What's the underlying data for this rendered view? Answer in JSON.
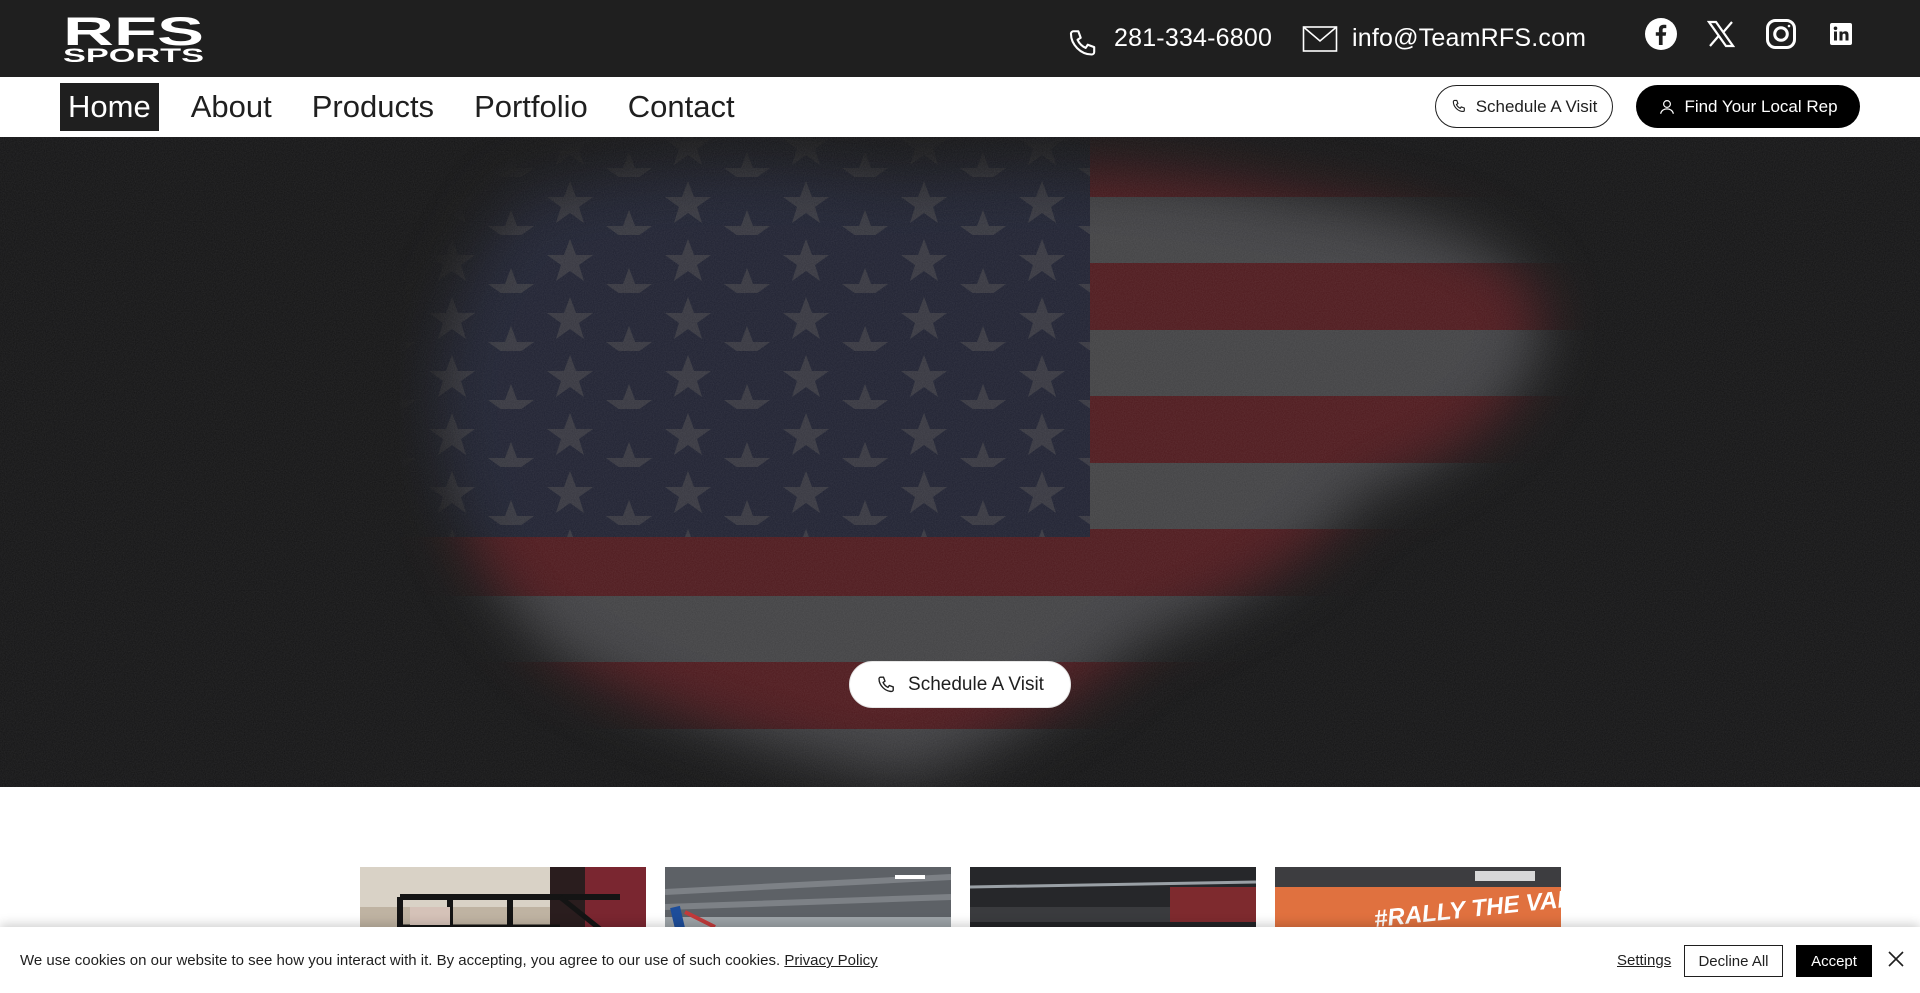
{
  "header": {
    "logo_line1": "RFS",
    "logo_line2": "SPORTS",
    "phone": "281-334-6800",
    "email": "info@TeamRFS.com",
    "socials": [
      "facebook-icon",
      "x-icon",
      "instagram-icon",
      "linkedin-icon"
    ]
  },
  "nav": {
    "items": [
      {
        "label": "Home",
        "active": true
      },
      {
        "label": "About",
        "active": false
      },
      {
        "label": "Products",
        "active": false
      },
      {
        "label": "Portfolio",
        "active": false
      },
      {
        "label": "Contact",
        "active": false
      }
    ],
    "schedule_label": "Schedule A Visit",
    "rep_label": "Find Your Local Rep"
  },
  "hero": {
    "button_label": "Schedule A Visit"
  },
  "gallery": {
    "thumb4_text": "#RALLY THE VALLEY"
  },
  "cookie": {
    "message": "We use cookies on our website to see how you interact with it. By accepting, you agree to our use of such cookies. ",
    "policy_link": "Privacy Policy",
    "settings": "Settings",
    "decline": "Decline All",
    "accept": "Accept"
  },
  "colors": {
    "topbar": "#1f1f1f",
    "hero_bg": "#1b1b1c",
    "flag_red": "#7a2a30",
    "flag_blue": "#2b2f45"
  }
}
